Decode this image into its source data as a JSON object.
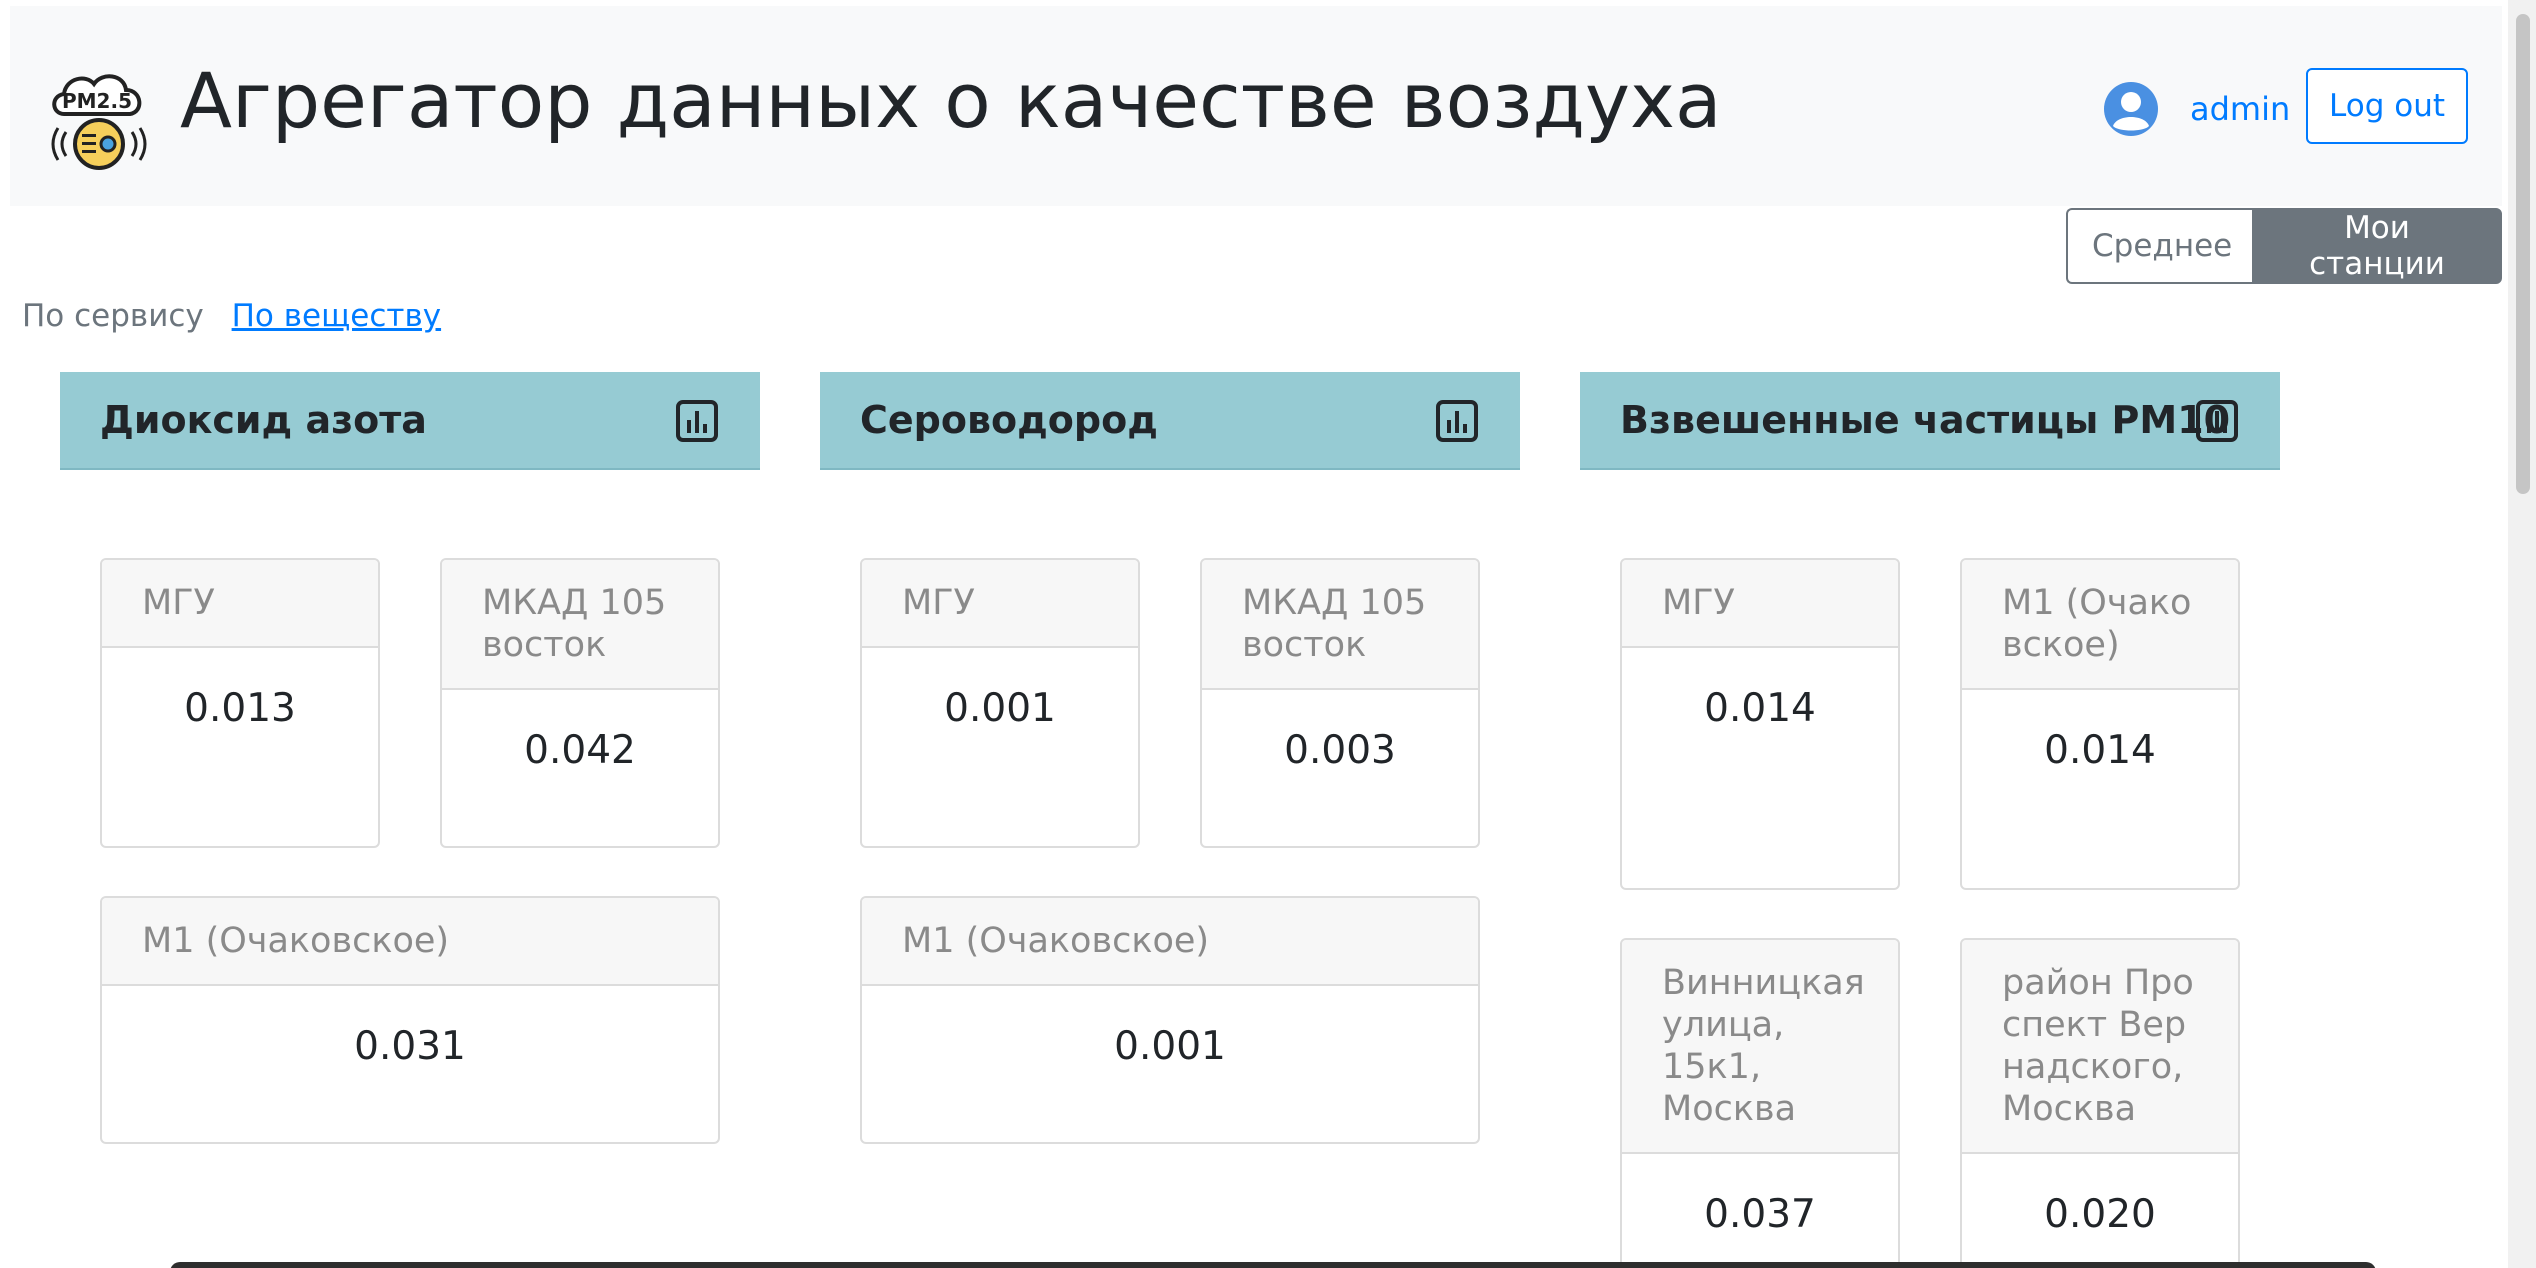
{
  "header": {
    "title": "Агрегатор данных о качестве воздуха",
    "logo_text": "PM2.5",
    "user_name": "admin",
    "logout_label": "Log out"
  },
  "toggle": {
    "average_label": "Среднее",
    "my_stations_label": "Мои станции",
    "active": "my_stations"
  },
  "filters": {
    "by_service": "По сервису",
    "by_substance": "По веществу"
  },
  "columns": [
    {
      "title": "Диоксид азота",
      "stations": [
        {
          "name": "МГУ",
          "value": "0.013"
        },
        {
          "name": "МКАД 105 восток",
          "value": "0.042"
        },
        {
          "name": "М1 (Очаковское)",
          "value": "0.031"
        }
      ]
    },
    {
      "title": "Сероводород",
      "stations": [
        {
          "name": "МГУ",
          "value": "0.001"
        },
        {
          "name": "МКАД 105 восток",
          "value": "0.003"
        },
        {
          "name": "М1 (Очаковское)",
          "value": "0.001"
        }
      ]
    },
    {
      "title": "Взвешенные частицы PM10",
      "stations": [
        {
          "name": "МГУ",
          "value": "0.014"
        },
        {
          "name": "М1 (Очаковское)",
          "value": "0.014"
        },
        {
          "name": "Винницкая улица, 15к1, Москва",
          "value": "0.037"
        },
        {
          "name": "район Проспект Вернадского, Москва",
          "value": "0.020"
        }
      ]
    }
  ],
  "icons": {
    "user": "user-circle-icon",
    "chart": "bar-chart-icon",
    "logo": "pm25-cloud-logo"
  },
  "colors": {
    "header_bg": "#f8f9fa",
    "primary": "#007bff",
    "secondary": "#6c757d",
    "column_header": "#96cbd3"
  }
}
